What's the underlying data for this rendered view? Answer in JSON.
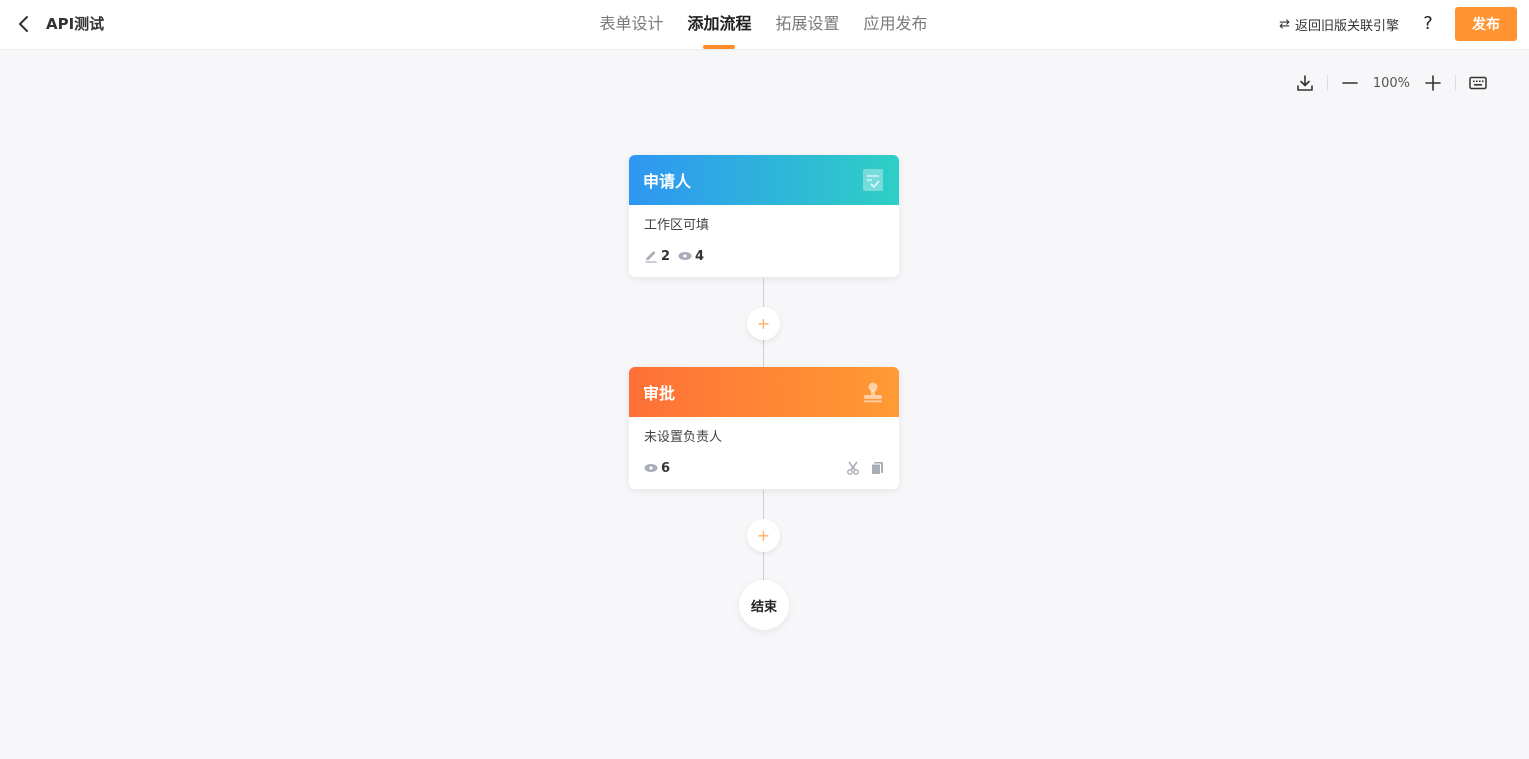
{
  "header": {
    "title": "API测试",
    "tabs": [
      {
        "label": "表单设计",
        "active": false
      },
      {
        "label": "添加流程",
        "active": true
      },
      {
        "label": "拓展设置",
        "active": false
      },
      {
        "label": "应用发布",
        "active": false
      }
    ],
    "legacy_link": "返回旧版关联引擎",
    "help": "?",
    "publish": "发布"
  },
  "toolbar": {
    "zoom": "100%",
    "icons": [
      "download-icon",
      "zoom-out-icon",
      "zoom-in-icon",
      "keyboard-icon"
    ]
  },
  "flow": {
    "applicant": {
      "title": "申请人",
      "desc": "工作区可填",
      "edit_count": "2",
      "view_count": "4"
    },
    "approval": {
      "title": "审批",
      "desc": "未设置负责人",
      "view_count": "6"
    },
    "add_symbol": "+",
    "end_label": "结束"
  },
  "colors": {
    "accent": "#ff9430",
    "applicant_gradient": [
      "#2f96f3",
      "#2ecfc4"
    ],
    "approval_gradient": [
      "#ff7036",
      "#ff9b34"
    ]
  }
}
